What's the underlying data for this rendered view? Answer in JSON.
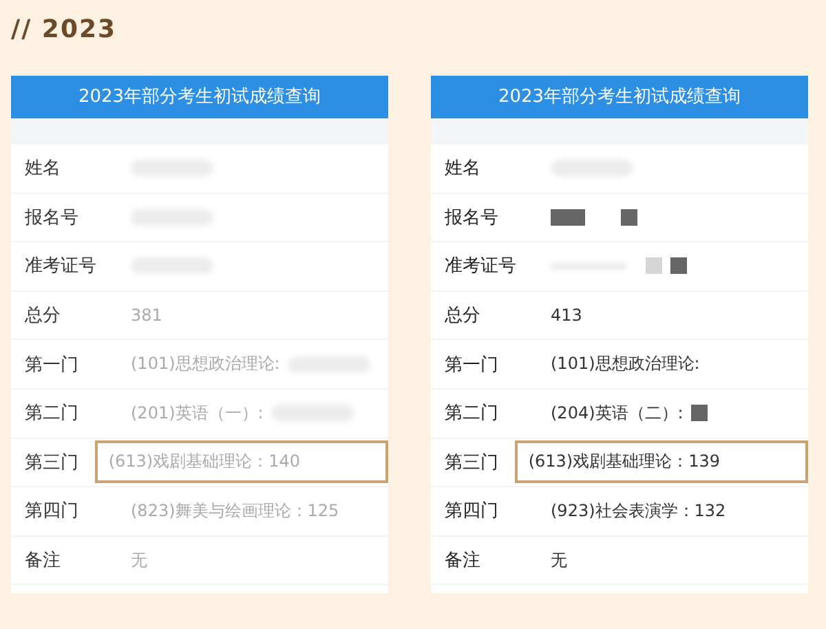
{
  "heading": "// 2023",
  "panels": [
    {
      "title": "2023年部分考生初试成绩查询",
      "faded": true,
      "rows": [
        {
          "label": "姓名",
          "redactions": [
            {
              "kind": "blur"
            }
          ],
          "highlighted": false
        },
        {
          "label": "报名号",
          "redactions": [
            {
              "kind": "blur"
            }
          ],
          "highlighted": false
        },
        {
          "label": "准考证号",
          "redactions": [
            {
              "kind": "blur"
            }
          ],
          "highlighted": false
        },
        {
          "label": "总分",
          "value": "381",
          "highlighted": false
        },
        {
          "label": "第一门",
          "value": "(101)思想政治理论:",
          "redactions": [
            {
              "kind": "blur"
            }
          ],
          "highlighted": false
        },
        {
          "label": "第二门",
          "value": "(201)英语（一）:",
          "redactions": [
            {
              "kind": "blur"
            }
          ],
          "highlighted": false
        },
        {
          "label": "第三门",
          "value": "(613)戏剧基础理论：140",
          "highlighted": true
        },
        {
          "label": "第四门",
          "value": "(823)舞美与绘画理论：125",
          "highlighted": false
        },
        {
          "label": "备注",
          "value": "无",
          "highlighted": false
        }
      ]
    },
    {
      "title": "2023年部分考生初试成绩查询",
      "faded": false,
      "rows": [
        {
          "label": "姓名",
          "redactions": [
            {
              "kind": "blur"
            }
          ],
          "highlighted": false
        },
        {
          "label": "报名号",
          "redactions": [
            {
              "kind": "wide"
            },
            {
              "kind": "block"
            }
          ],
          "highlighted": false
        },
        {
          "label": "准考证号",
          "redactions": [
            {
              "kind": "line"
            },
            {
              "kind": "light"
            },
            {
              "kind": "block"
            }
          ],
          "highlighted": false
        },
        {
          "label": "总分",
          "value": "413",
          "highlighted": false
        },
        {
          "label": "第一门",
          "value": "(101)思想政治理论:",
          "highlighted": false
        },
        {
          "label": "第二门",
          "value": "(204)英语（二）:",
          "redactions": [
            {
              "kind": "block"
            }
          ],
          "highlighted": false
        },
        {
          "label": "第三门",
          "value": "(613)戏剧基础理论：139",
          "highlighted": true
        },
        {
          "label": "第四门",
          "value": "(923)社会表演学：132",
          "highlighted": false
        },
        {
          "label": "备注",
          "value": "无",
          "highlighted": false
        }
      ]
    }
  ]
}
